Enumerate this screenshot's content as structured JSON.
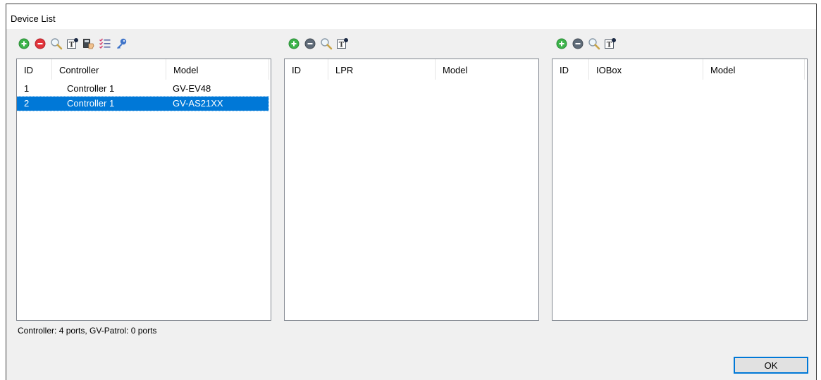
{
  "window": {
    "title": "Device List"
  },
  "colors": {
    "accent": "#0078d7",
    "add_green": "#3cb34a",
    "remove_red": "#e2343b",
    "remove_gray": "#5f6b78"
  },
  "controllers": {
    "toolbar": [
      {
        "name": "add-controller-button",
        "icon": "add-circle-green-icon"
      },
      {
        "name": "remove-controller-button",
        "icon": "remove-circle-red-icon"
      },
      {
        "name": "search-controller-button",
        "icon": "magnifier-icon"
      },
      {
        "name": "properties-controller-button",
        "icon": "text-properties-icon"
      },
      {
        "name": "assign-controller-button",
        "icon": "hand-card-icon"
      },
      {
        "name": "checklist-controller-button",
        "icon": "checklist-icon"
      },
      {
        "name": "key-controller-button",
        "icon": "key-icon"
      }
    ],
    "columns": [
      "ID",
      "Controller",
      "Model"
    ],
    "rows": [
      {
        "id": "1",
        "controller": "Controller 1",
        "model": "GV-EV48",
        "selected": false
      },
      {
        "id": "2",
        "controller": "Controller 1",
        "model": "GV-AS21XX",
        "selected": true
      }
    ]
  },
  "lpr": {
    "toolbar": [
      {
        "name": "add-lpr-button",
        "icon": "add-circle-green-icon"
      },
      {
        "name": "remove-lpr-button",
        "icon": "remove-circle-gray-icon"
      },
      {
        "name": "search-lpr-button",
        "icon": "magnifier-icon"
      },
      {
        "name": "properties-lpr-button",
        "icon": "text-properties-icon"
      }
    ],
    "columns": [
      "ID",
      "LPR",
      "Model"
    ],
    "rows": []
  },
  "iobox": {
    "toolbar": [
      {
        "name": "add-iobox-button",
        "icon": "add-circle-green-icon"
      },
      {
        "name": "remove-iobox-button",
        "icon": "remove-circle-gray-icon"
      },
      {
        "name": "search-iobox-button",
        "icon": "magnifier-icon"
      },
      {
        "name": "properties-iobox-button",
        "icon": "text-properties-icon"
      }
    ],
    "columns": [
      "ID",
      "IOBox",
      "Model"
    ],
    "rows": []
  },
  "status": {
    "text": "Controller: 4 ports, GV-Patrol: 0 ports"
  },
  "buttons": {
    "ok_label": "OK"
  }
}
